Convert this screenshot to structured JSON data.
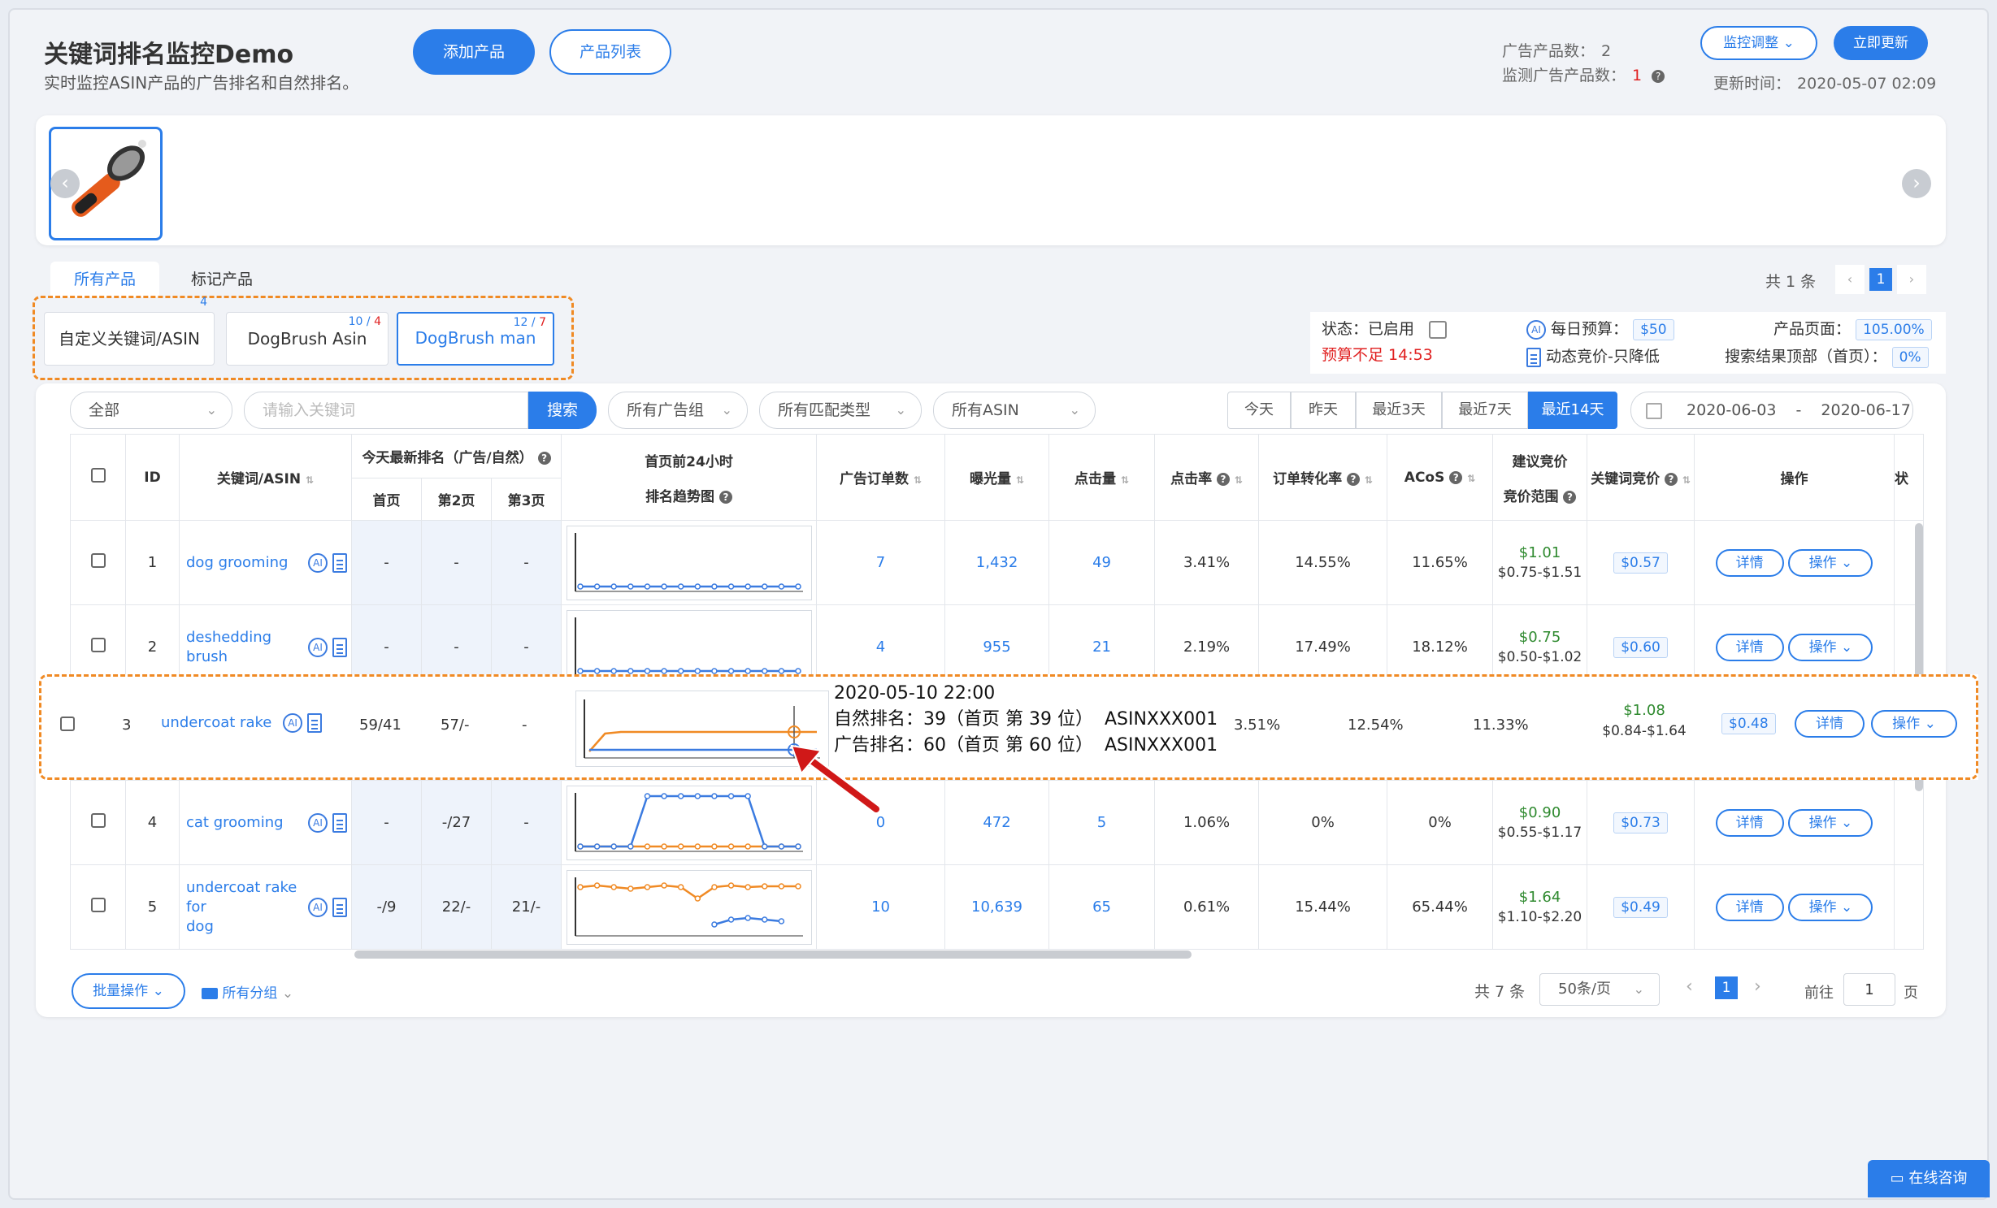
{
  "header": {
    "title": "关键词排名监控Demo",
    "subtitle": "实时监控ASIN产品的广告排名和自然排名。",
    "add_product": "添加产品",
    "product_list": "产品列表",
    "ad_products_label": "广告产品数：",
    "ad_products_value": "2",
    "monitored_label": "监测广告产品数：",
    "monitored_value": "1",
    "monitor_adjust": "监控调整",
    "update_now": "立即更新",
    "update_time_label": "更新时间：",
    "update_time": "2020-05-07 02:09"
  },
  "tabs": {
    "all_products": "所有产品",
    "marked_products": "标记产品",
    "total": "共 1 条",
    "page": "1"
  },
  "keyword_tabs": [
    {
      "label": "自定义关键词/ASIN",
      "count": "4",
      "count_red": ""
    },
    {
      "label": "DogBrush Asin",
      "count": "10 / ",
      "count_red": "4"
    },
    {
      "label": "DogBrush man",
      "count": "12 / ",
      "count_red": "7"
    }
  ],
  "status": {
    "state_label": "状态：",
    "state_value": "已启用",
    "budget_warning": "预算不足 14:53",
    "daily_budget_label": "每日预算：",
    "daily_budget": "$50",
    "bid_strategy": "动态竞价-只降低",
    "product_page_label": "产品页面：",
    "product_page_value": "105.00%",
    "search_top_label": "搜索结果顶部（首页）：",
    "search_top_value": "0%"
  },
  "filters": {
    "all": "全部",
    "search_placeholder": "请输入关键词",
    "search_button": "搜索",
    "ad_groups": "所有广告组",
    "match_types": "所有匹配类型",
    "asins": "所有ASIN",
    "ranges": [
      "今天",
      "昨天",
      "最近3天",
      "最近7天",
      "最近14天"
    ],
    "active_range": "最近14天",
    "date_start": "2020-06-03",
    "date_sep": "-",
    "date_end": "2020-06-17"
  },
  "table": {
    "headers": {
      "id": "ID",
      "keyword": "关键词/ASIN",
      "today_rank": "今天最新排名（广告/自然）",
      "page1": "首页",
      "page2": "第2页",
      "page3": "第3页",
      "trend_line1": "首页前24小时",
      "trend_line2": "排名趋势图",
      "orders": "广告订单数",
      "impressions": "曝光量",
      "clicks": "点击量",
      "ctr": "点击率",
      "cvr": "订单转化率",
      "acos": "ACoS",
      "suggest_line1": "建议竞价",
      "suggest_line2": "竞价范围",
      "kw_bid": "关键词竞价",
      "actions": "操作",
      "cut": "状"
    },
    "rows": [
      {
        "id": "1",
        "keyword": "dog grooming",
        "p1": "-",
        "p2": "-",
        "p3": "-",
        "orders": "7",
        "impressions": "1,432",
        "clicks": "49",
        "ctr": "3.41%",
        "cvr": "14.55%",
        "acos": "11.65%",
        "suggest": "$1.01",
        "range": "$0.75-$1.51",
        "bid": "$0.57"
      },
      {
        "id": "2",
        "keyword": "deshedding brush",
        "p1": "-",
        "p2": "-",
        "p3": "-",
        "orders": "4",
        "impressions": "955",
        "clicks": "21",
        "ctr": "2.19%",
        "cvr": "17.49%",
        "acos": "18.12%",
        "suggest": "$0.75",
        "range": "$0.50-$1.02",
        "bid": "$0.60"
      },
      {
        "id": "3",
        "keyword": "undercoat rake",
        "p1": "59/41",
        "p2": "57/-",
        "p3": "-",
        "orders": "",
        "impressions": "",
        "clicks": "",
        "ctr": "3.51%",
        "cvr": "12.54%",
        "acos": "11.33%",
        "suggest": "$1.08",
        "range": "$0.84-$1.64",
        "bid": "$0.48"
      },
      {
        "id": "4",
        "keyword": "cat grooming",
        "p1": "-",
        "p2": "-/27",
        "p3": "-",
        "orders": "0",
        "impressions": "472",
        "clicks": "5",
        "ctr": "1.06%",
        "cvr": "0%",
        "acos": "0%",
        "suggest": "$0.90",
        "range": "$0.55-$1.17",
        "bid": "$0.73"
      },
      {
        "id": "5",
        "keyword": "undercoat rake for",
        "keyword2": "dog",
        "p1": "-/9",
        "p2": "22/-",
        "p3": "21/-",
        "orders": "10",
        "impressions": "10,639",
        "clicks": "65",
        "ctr": "0.61%",
        "cvr": "15.44%",
        "acos": "65.44%",
        "suggest": "$1.64",
        "range": "$1.10-$2.20",
        "bid": "$0.49"
      }
    ],
    "detail_btn": "详情",
    "action_btn": "操作"
  },
  "tooltip": {
    "time": "2020-05-10 22:00",
    "organic": "自然排名：39（首页 第 39 位）  ASINXXX001",
    "ad": "广告排名：60（首页 第 60 位）  ASINXXX001"
  },
  "footer": {
    "batch": "批量操作",
    "groups": "所有分组",
    "total": "共 7 条",
    "per_page": "50条/页",
    "page": "1",
    "goto": "前往",
    "goto_value": "1",
    "page_suffix": "页",
    "chat": "在线咨询"
  },
  "colors": {
    "primary": "#2b7de9",
    "warning": "#e02020",
    "highlight": "#f08a24",
    "organic_line": "#f08a24",
    "ad_line": "#3b7be0"
  }
}
